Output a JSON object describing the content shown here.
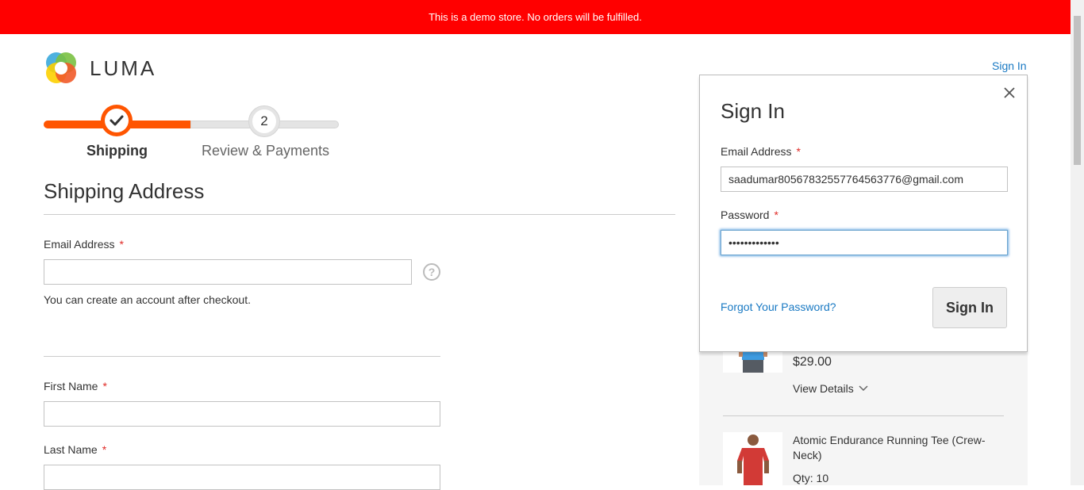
{
  "banner": {
    "text": "This is a demo store. No orders will be fulfilled."
  },
  "header": {
    "logo_text": "LUMA",
    "signin_link": "Sign In"
  },
  "progress": {
    "steps": [
      {
        "number": "1",
        "label": "Shipping",
        "state": "complete"
      },
      {
        "number": "2",
        "label": "Review & Payments",
        "state": "pending"
      }
    ],
    "colors": {
      "active": "#ff5501",
      "inactive": "#e4e4e4"
    }
  },
  "shipping": {
    "title": "Shipping Address",
    "email_label": "Email Address",
    "email_value": "",
    "email_note": "You can create an account after checkout.",
    "first_name_label": "First Name",
    "first_name_value": "",
    "last_name_label": "Last Name",
    "last_name_value": "",
    "required_mark": "*",
    "help_icon": "question-circle-icon"
  },
  "summary": {
    "items": [
      {
        "price": "$29.00",
        "view_details": "View Details"
      },
      {
        "name": "Atomic Endurance Running Tee (Crew-Neck)",
        "qty": "Qty: 10"
      }
    ]
  },
  "signin_modal": {
    "title": "Sign In",
    "email_label": "Email Address",
    "email_value": "saadumar80567832557764563776@gmail.com",
    "password_label": "Password",
    "password_value": "•••••••••••••",
    "required_mark": "*",
    "forgot_link": "Forgot Your Password?",
    "submit_label": "Sign In",
    "close_icon": "close-icon"
  },
  "colors": {
    "banner": "#ff0000",
    "link": "#1979c3",
    "required": "#e02b27",
    "accent": "#ff5501"
  }
}
